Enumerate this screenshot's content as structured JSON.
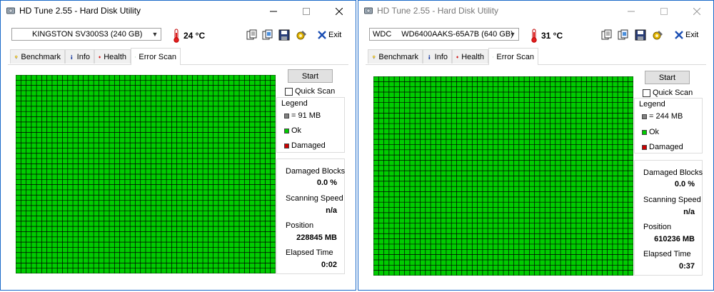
{
  "windows": [
    {
      "title": "HD Tune 2.55 - Hard Disk Utility",
      "drive": "KINGSTON SV300S3 (240 GB)",
      "temperature": "24 °C",
      "exit_label": "Exit",
      "tabs": [
        {
          "label": "Benchmark",
          "icon": "bulb-icon"
        },
        {
          "label": "Info",
          "icon": "info-icon"
        },
        {
          "label": "Health",
          "icon": "health-cross-icon"
        },
        {
          "label": "Error Scan",
          "icon": "magnifier-icon",
          "active": true
        }
      ],
      "start_label": "Start",
      "quick_scan_label": "Quick Scan",
      "quick_scan_checked": false,
      "legend": {
        "title": "Legend",
        "block_size": "= 91 MB",
        "ok_label": "Ok",
        "damaged_label": "Damaged"
      },
      "stats": {
        "damaged_blocks_label": "Damaged Blocks",
        "damaged_blocks_value": "0.0 %",
        "scanning_speed_label": "Scanning Speed",
        "scanning_speed_value": "n/a",
        "position_label": "Position",
        "position_value": "228845 MB",
        "elapsed_time_label": "Elapsed Time",
        "elapsed_time_value": "0:02"
      }
    },
    {
      "title": "HD Tune 2.55 - Hard Disk Utility",
      "drive_prefix": "WDC",
      "drive": "WD6400AAKS-65A7B (640 GB)",
      "temperature": "31 °C",
      "exit_label": "Exit",
      "tabs": [
        {
          "label": "Benchmark",
          "icon": "bulb-icon"
        },
        {
          "label": "Info",
          "icon": "info-icon"
        },
        {
          "label": "Health",
          "icon": "health-cross-icon"
        },
        {
          "label": "Error Scan",
          "icon": "magnifier-icon",
          "active": true
        }
      ],
      "start_label": "Start",
      "quick_scan_label": "Quick Scan",
      "quick_scan_checked": false,
      "legend": {
        "title": "Legend",
        "block_size": "= 244 MB",
        "ok_label": "Ok",
        "damaged_label": "Damaged"
      },
      "stats": {
        "damaged_blocks_label": "Damaged Blocks",
        "damaged_blocks_value": "0.0 %",
        "scanning_speed_label": "Scanning Speed",
        "scanning_speed_value": "n/a",
        "position_label": "Position",
        "position_value": "610236 MB",
        "elapsed_time_label": "Elapsed Time",
        "elapsed_time_value": "0:37"
      }
    }
  ],
  "colors": {
    "window_border": "#1b6ac9",
    "block_ok": "#00cc00",
    "block_grid_line": "#000000",
    "legend_gray": "#808080",
    "legend_ok": "#00cc00",
    "legend_damaged": "#cc0000"
  },
  "scan_result": "all blocks ok"
}
